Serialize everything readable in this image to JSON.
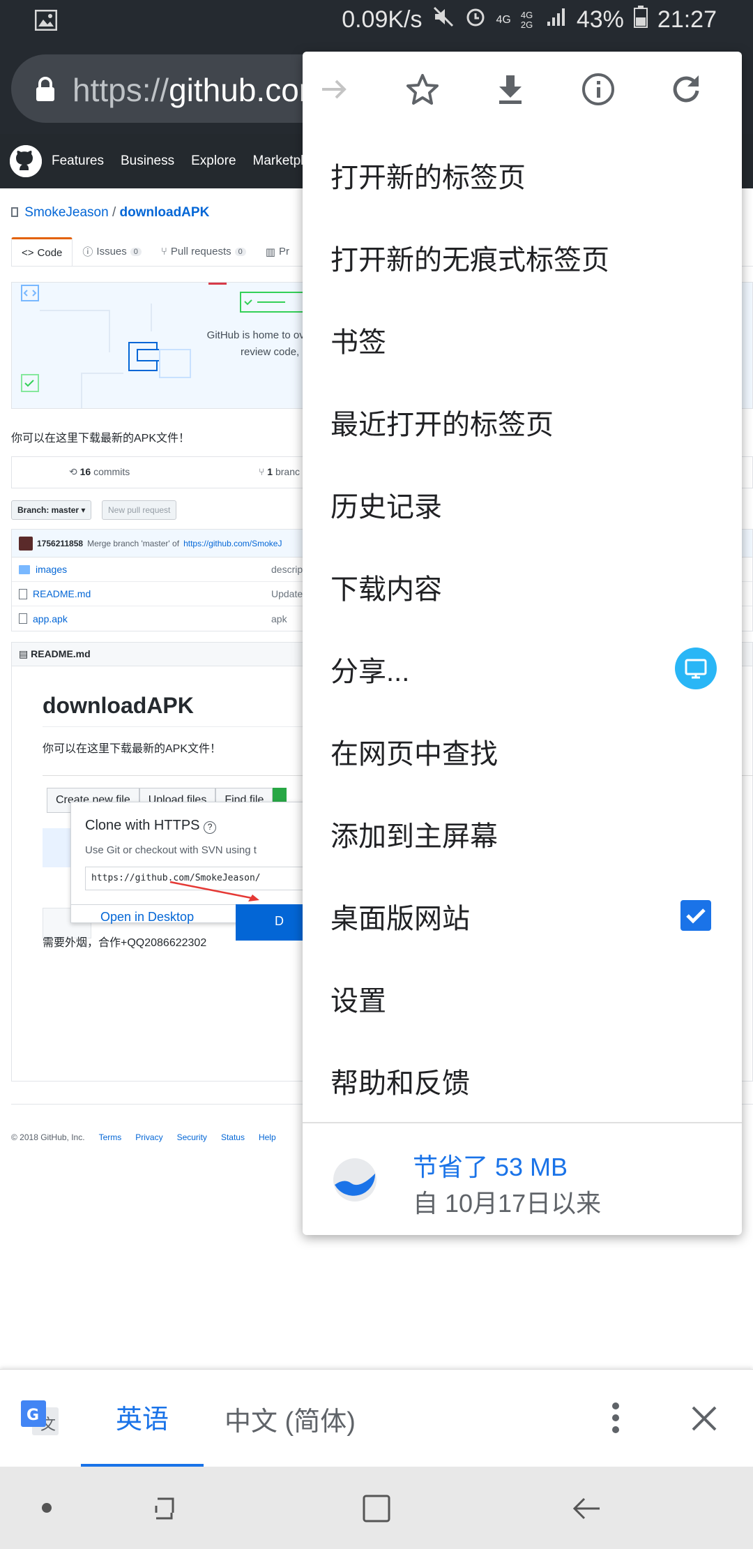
{
  "status_bar": {
    "speed": "0.09K/s",
    "network_a": "4G",
    "network_b": "4G 2G",
    "battery": "43%",
    "time": "21:27"
  },
  "url_bar": {
    "scheme": "https://",
    "host": "github.com"
  },
  "gh_nav": [
    "Features",
    "Business",
    "Explore",
    "Marketplace"
  ],
  "repo": {
    "owner": "SmokeJeason",
    "separator": "/",
    "name": "downloadAPK",
    "tabs": [
      {
        "label": "Code"
      },
      {
        "label": "Issues",
        "count": "0"
      },
      {
        "label": "Pull requests",
        "count": "0"
      },
      {
        "label": "Pr"
      }
    ],
    "hero_text_1": "GitHub is home to ov",
    "hero_text_2": "review code, r",
    "description": "你可以在这里下载最新的APK文件！",
    "commits_count": "16",
    "commits_label": "commits",
    "branch_count": "1",
    "branch_label": "branc",
    "branch_button": "Branch: master ▾",
    "new_pr_button": "New pull request",
    "last_commit_user": "1756211858",
    "last_commit_msg": "Merge branch 'master' of",
    "last_commit_link": "https://github.com/SmokeJ",
    "files": [
      {
        "icon": "folder",
        "name": "images",
        "msg": "descrip"
      },
      {
        "icon": "file",
        "name": "README.md",
        "msg": "Update"
      },
      {
        "icon": "file",
        "name": "app.apk",
        "msg": "apk"
      }
    ],
    "readme_header": "README.md",
    "readme_title": "downloadAPK",
    "readme_desc": "你可以在这里下载最新的APK文件！",
    "shot_buttons": [
      "Create new file",
      "Upload files",
      "Find file"
    ],
    "clone_title": "Clone with HTTPS",
    "clone_help": "?",
    "clone_desc": "Use Git or checkout with SVN using t",
    "clone_url": "https://github.com/SmokeJeason/",
    "open_desktop": "Open in Desktop",
    "download_btn_fragment": "D",
    "readme_footer": "需要外烟，合作+QQ2086622302"
  },
  "footer": {
    "copyright": "© 2018 GitHub, Inc.",
    "links": [
      "Terms",
      "Privacy",
      "Security",
      "Status",
      "Help"
    ]
  },
  "menu": {
    "icons": [
      "forward-icon",
      "star-icon",
      "download-icon",
      "info-icon",
      "refresh-icon"
    ],
    "items": [
      {
        "label": "打开新的标签页"
      },
      {
        "label": "打开新的无痕式标签页"
      },
      {
        "label": "书签"
      },
      {
        "label": "最近打开的标签页"
      },
      {
        "label": "历史记录"
      },
      {
        "label": "下载内容"
      },
      {
        "label": "分享..."
      },
      {
        "label": "在网页中查找"
      },
      {
        "label": "添加到主屏幕"
      },
      {
        "label": "桌面版网站",
        "checked": true
      },
      {
        "label": "设置"
      },
      {
        "label": "帮助和反馈"
      }
    ],
    "savings_title": "节省了 53 MB",
    "savings_sub": "自 10月17日以来"
  },
  "translate": {
    "source_lang": "英语",
    "target_lang": "中文 (简体)",
    "accent": "#1a73e8"
  }
}
